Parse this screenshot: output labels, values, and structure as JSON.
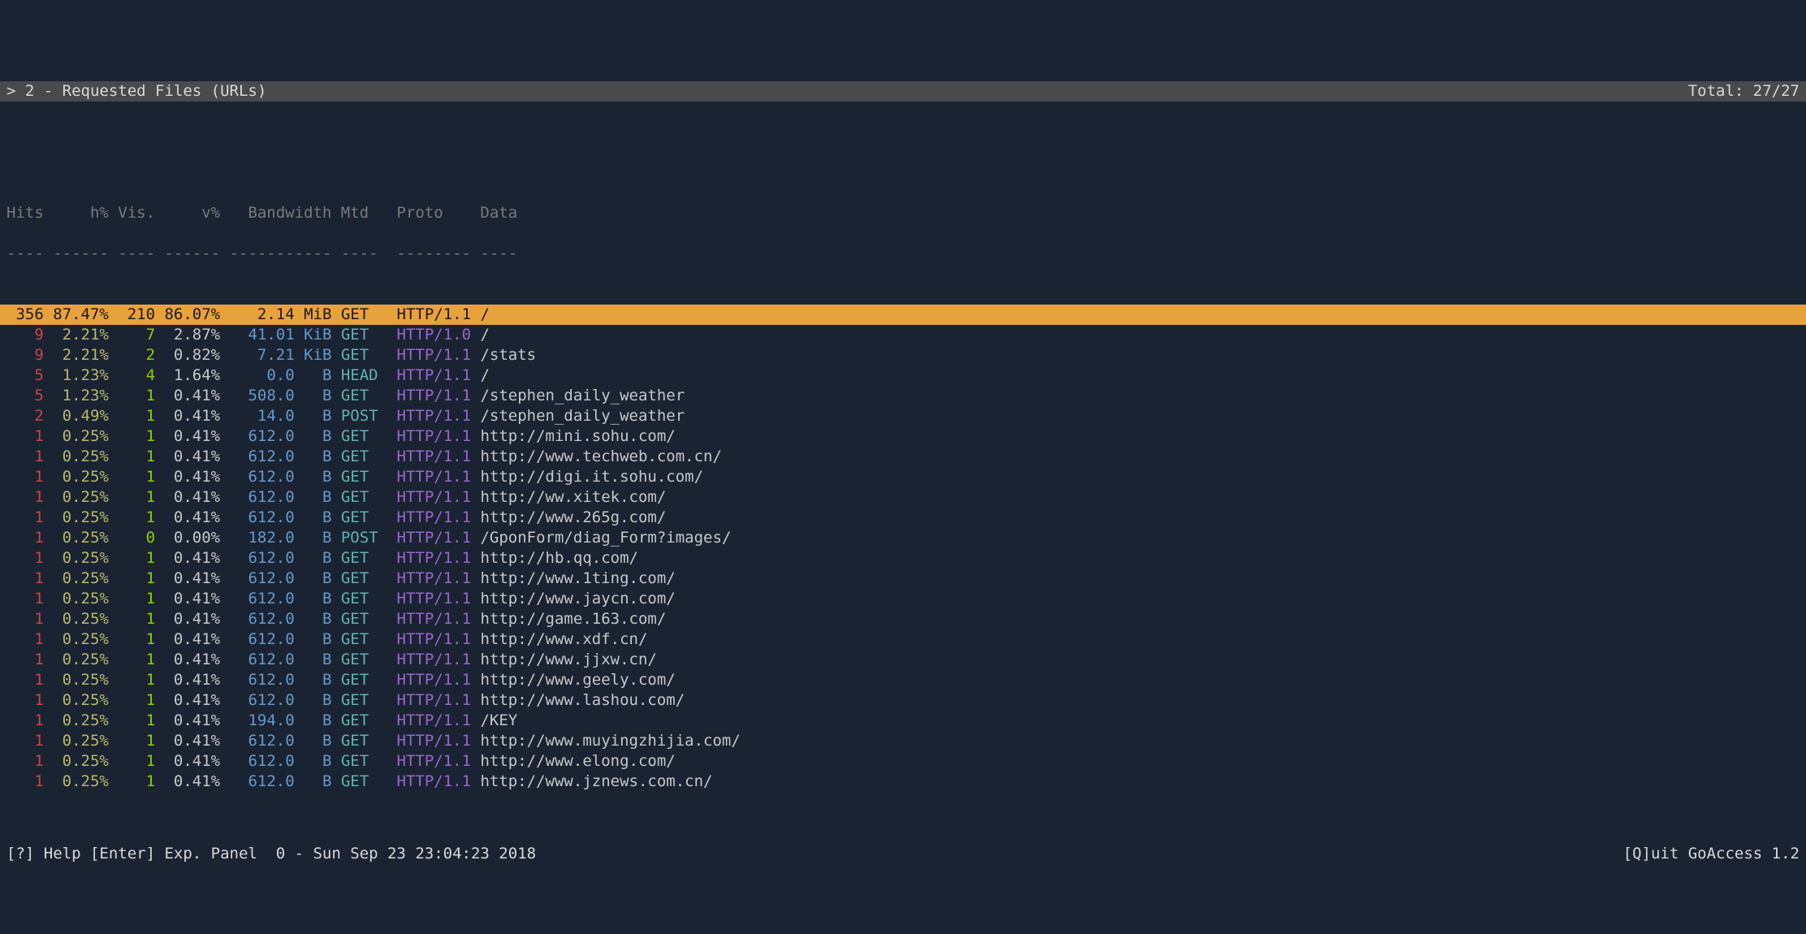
{
  "header": {
    "title": "> 2 - Requested Files (URLs)",
    "total": "Total: 27/27"
  },
  "columns": {
    "headers": "Hits     h% Vis.     v%   Bandwidth Mtd   Proto    Data",
    "dashes": "---- ------ ---- ------ ----------- ----  -------- ----"
  },
  "rows": [
    {
      "selected": true,
      "hits": "356",
      "hpct": "87.47%",
      "vis": "210",
      "vpct": "86.07%",
      "bw": "2.14",
      "unit": "MiB",
      "mtd": "GET ",
      "proto": "HTTP/1.1",
      "data": "/"
    },
    {
      "selected": false,
      "hits": "9",
      "hpct": "2.21%",
      "vis": "7",
      "vpct": "2.87%",
      "bw": "41.01",
      "unit": "KiB",
      "mtd": "GET ",
      "proto": "HTTP/1.0",
      "data": "/"
    },
    {
      "selected": false,
      "hits": "9",
      "hpct": "2.21%",
      "vis": "2",
      "vpct": "0.82%",
      "bw": "7.21",
      "unit": "KiB",
      "mtd": "GET ",
      "proto": "HTTP/1.1",
      "data": "/stats"
    },
    {
      "selected": false,
      "hits": "5",
      "hpct": "1.23%",
      "vis": "4",
      "vpct": "1.64%",
      "bw": "0.0",
      "unit": "  B",
      "mtd": "HEAD",
      "proto": "HTTP/1.1",
      "data": "/"
    },
    {
      "selected": false,
      "hits": "5",
      "hpct": "1.23%",
      "vis": "1",
      "vpct": "0.41%",
      "bw": "508.0",
      "unit": "  B",
      "mtd": "GET ",
      "proto": "HTTP/1.1",
      "data": "/stephen_daily_weather"
    },
    {
      "selected": false,
      "hits": "2",
      "hpct": "0.49%",
      "vis": "1",
      "vpct": "0.41%",
      "bw": "14.0",
      "unit": "  B",
      "mtd": "POST",
      "proto": "HTTP/1.1",
      "data": "/stephen_daily_weather"
    },
    {
      "selected": false,
      "hits": "1",
      "hpct": "0.25%",
      "vis": "1",
      "vpct": "0.41%",
      "bw": "612.0",
      "unit": "  B",
      "mtd": "GET ",
      "proto": "HTTP/1.1",
      "data": "http://mini.sohu.com/"
    },
    {
      "selected": false,
      "hits": "1",
      "hpct": "0.25%",
      "vis": "1",
      "vpct": "0.41%",
      "bw": "612.0",
      "unit": "  B",
      "mtd": "GET ",
      "proto": "HTTP/1.1",
      "data": "http://www.techweb.com.cn/"
    },
    {
      "selected": false,
      "hits": "1",
      "hpct": "0.25%",
      "vis": "1",
      "vpct": "0.41%",
      "bw": "612.0",
      "unit": "  B",
      "mtd": "GET ",
      "proto": "HTTP/1.1",
      "data": "http://digi.it.sohu.com/"
    },
    {
      "selected": false,
      "hits": "1",
      "hpct": "0.25%",
      "vis": "1",
      "vpct": "0.41%",
      "bw": "612.0",
      "unit": "  B",
      "mtd": "GET ",
      "proto": "HTTP/1.1",
      "data": "http://ww.xitek.com/"
    },
    {
      "selected": false,
      "hits": "1",
      "hpct": "0.25%",
      "vis": "1",
      "vpct": "0.41%",
      "bw": "612.0",
      "unit": "  B",
      "mtd": "GET ",
      "proto": "HTTP/1.1",
      "data": "http://www.265g.com/"
    },
    {
      "selected": false,
      "hits": "1",
      "hpct": "0.25%",
      "vis": "0",
      "vpct": "0.00%",
      "bw": "182.0",
      "unit": "  B",
      "mtd": "POST",
      "proto": "HTTP/1.1",
      "data": "/GponForm/diag_Form?images/"
    },
    {
      "selected": false,
      "hits": "1",
      "hpct": "0.25%",
      "vis": "1",
      "vpct": "0.41%",
      "bw": "612.0",
      "unit": "  B",
      "mtd": "GET ",
      "proto": "HTTP/1.1",
      "data": "http://hb.qq.com/"
    },
    {
      "selected": false,
      "hits": "1",
      "hpct": "0.25%",
      "vis": "1",
      "vpct": "0.41%",
      "bw": "612.0",
      "unit": "  B",
      "mtd": "GET ",
      "proto": "HTTP/1.1",
      "data": "http://www.1ting.com/"
    },
    {
      "selected": false,
      "hits": "1",
      "hpct": "0.25%",
      "vis": "1",
      "vpct": "0.41%",
      "bw": "612.0",
      "unit": "  B",
      "mtd": "GET ",
      "proto": "HTTP/1.1",
      "data": "http://www.jaycn.com/"
    },
    {
      "selected": false,
      "hits": "1",
      "hpct": "0.25%",
      "vis": "1",
      "vpct": "0.41%",
      "bw": "612.0",
      "unit": "  B",
      "mtd": "GET ",
      "proto": "HTTP/1.1",
      "data": "http://game.163.com/"
    },
    {
      "selected": false,
      "hits": "1",
      "hpct": "0.25%",
      "vis": "1",
      "vpct": "0.41%",
      "bw": "612.0",
      "unit": "  B",
      "mtd": "GET ",
      "proto": "HTTP/1.1",
      "data": "http://www.xdf.cn/"
    },
    {
      "selected": false,
      "hits": "1",
      "hpct": "0.25%",
      "vis": "1",
      "vpct": "0.41%",
      "bw": "612.0",
      "unit": "  B",
      "mtd": "GET ",
      "proto": "HTTP/1.1",
      "data": "http://www.jjxw.cn/"
    },
    {
      "selected": false,
      "hits": "1",
      "hpct": "0.25%",
      "vis": "1",
      "vpct": "0.41%",
      "bw": "612.0",
      "unit": "  B",
      "mtd": "GET ",
      "proto": "HTTP/1.1",
      "data": "http://www.geely.com/"
    },
    {
      "selected": false,
      "hits": "1",
      "hpct": "0.25%",
      "vis": "1",
      "vpct": "0.41%",
      "bw": "612.0",
      "unit": "  B",
      "mtd": "GET ",
      "proto": "HTTP/1.1",
      "data": "http://www.lashou.com/"
    },
    {
      "selected": false,
      "hits": "1",
      "hpct": "0.25%",
      "vis": "1",
      "vpct": "0.41%",
      "bw": "194.0",
      "unit": "  B",
      "mtd": "GET ",
      "proto": "HTTP/1.1",
      "data": "/KEY"
    },
    {
      "selected": false,
      "hits": "1",
      "hpct": "0.25%",
      "vis": "1",
      "vpct": "0.41%",
      "bw": "612.0",
      "unit": "  B",
      "mtd": "GET ",
      "proto": "HTTP/1.1",
      "data": "http://www.muyingzhijia.com/"
    },
    {
      "selected": false,
      "hits": "1",
      "hpct": "0.25%",
      "vis": "1",
      "vpct": "0.41%",
      "bw": "612.0",
      "unit": "  B",
      "mtd": "GET ",
      "proto": "HTTP/1.1",
      "data": "http://www.elong.com/"
    },
    {
      "selected": false,
      "hits": "1",
      "hpct": "0.25%",
      "vis": "1",
      "vpct": "0.41%",
      "bw": "612.0",
      "unit": "  B",
      "mtd": "GET ",
      "proto": "HTTP/1.1",
      "data": "http://www.jznews.com.cn/"
    }
  ],
  "footer": {
    "left": "[?] Help [Enter] Exp. Panel  0 - Sun Sep 23 23:04:23 2018",
    "right": "[Q]uit GoAccess 1.2"
  }
}
